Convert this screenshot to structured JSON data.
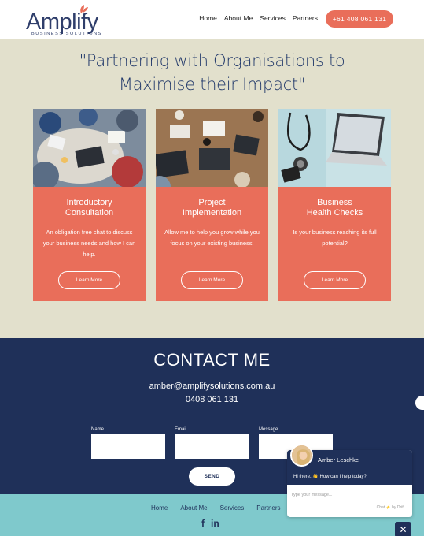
{
  "header": {
    "logo_word": "Amplify",
    "logo_sub": "BUSINESS SOLUTIONS",
    "nav": [
      "Home",
      "About Me",
      "Services",
      "Partners"
    ],
    "phone": "+61 408 061 131"
  },
  "hero": {
    "title_line1": "\"Partnering with Organisations to",
    "title_line2": "Maximise their Impact\""
  },
  "cards": [
    {
      "title1": "Introductory",
      "title2": "Consultation",
      "desc": "An obligation free chat to discuss your business needs and how I can help.",
      "button": "Learn More"
    },
    {
      "title1": "Project",
      "title2": "Implementation",
      "desc": "Allow me to help you grow while you focus on your existing business.",
      "button": "Learn More"
    },
    {
      "title1": "Business",
      "title2": "Health Checks",
      "desc": "Is your business reaching its full potential?",
      "button": "Learn More"
    }
  ],
  "contact": {
    "title": "CONTACT ME",
    "email": "amber@amplifysolutions.com.au",
    "phone": "0408 061 131",
    "labels": [
      "Name",
      "Email",
      "Message"
    ],
    "send": "SEND"
  },
  "footer": {
    "nav": [
      "Home",
      "About Me",
      "Services",
      "Partners"
    ],
    "social": [
      "f",
      "in"
    ]
  },
  "chat": {
    "name": "Amber Leschke",
    "greeting": "Hi there. 👋 How can I help today?",
    "placeholder": "Type your message...",
    "brand": "Chat ⚡ by Drift",
    "close": "✕"
  },
  "colors": {
    "accent": "#e96e5a",
    "navy": "#1f3059",
    "beige": "#e2e0cc",
    "teal": "#7fc9cc"
  }
}
